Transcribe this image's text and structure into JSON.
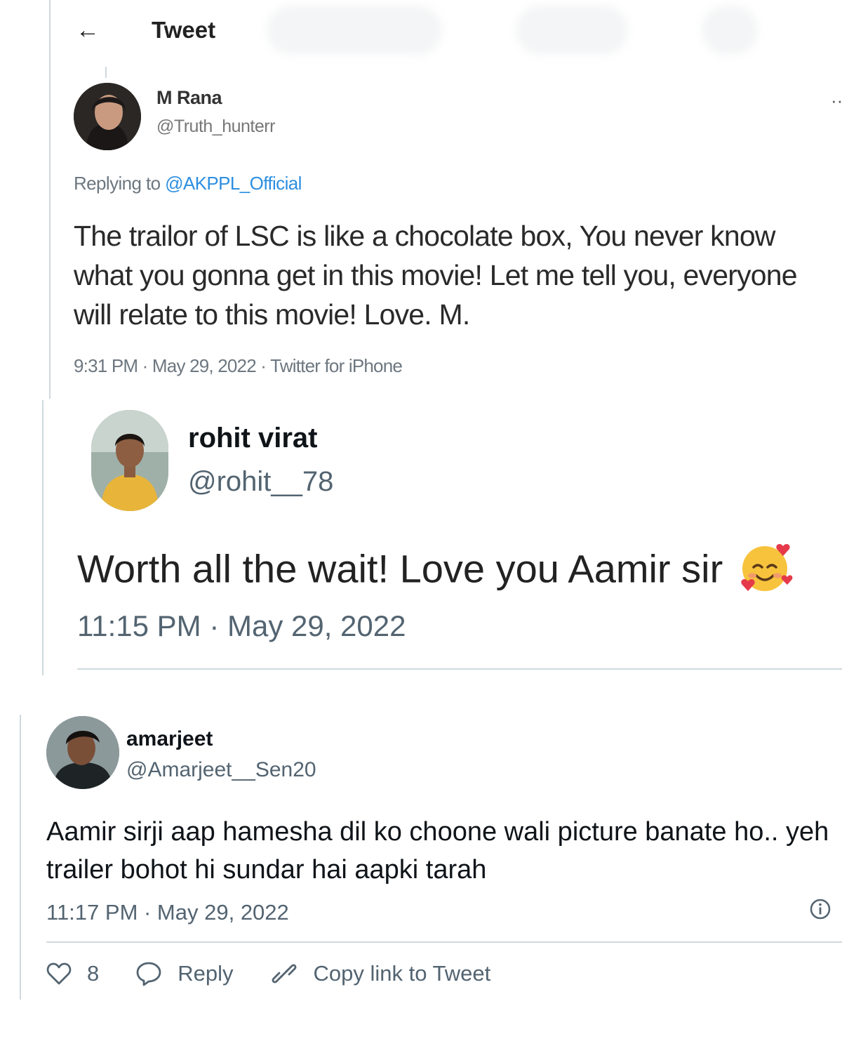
{
  "tweet1": {
    "header_title": "Tweet",
    "name": "M Rana",
    "handle": "@Truth_hunterr",
    "replying_prefix": "Replying to",
    "replying_to": "@AKPPL_Official",
    "text": "The trailor of LSC is like a chocolate box, You never know what you gonna get in this movie! Let me tell you, everyone will relate to this movie! Love. M.",
    "meta": "9:31 PM · May 29, 2022 · Twitter for iPhone"
  },
  "tweet2": {
    "name": "rohit virat",
    "handle": "@rohit__78",
    "text": "Worth all the wait! Love you Aamir sir",
    "emoji": "smiling-face-with-hearts",
    "meta": "11:15 PM · May 29, 2022"
  },
  "tweet3": {
    "name": "amarjeet",
    "handle": "@Amarjeet__Sen20",
    "text": "Aamir sirji aap hamesha dil ko choone wali picture banate ho.. yeh trailer bohot hi sundar hai aapki tarah",
    "meta": "11:17 PM · May 29, 2022",
    "likes": "8",
    "reply_label": "Reply",
    "copy_label": "Copy link to Tweet"
  },
  "icons": {
    "back": "arrow-left-icon",
    "more": "more-dots-icon",
    "info": "info-icon",
    "like": "heart-icon",
    "reply": "speech-bubble-icon",
    "copy": "link-icon"
  },
  "colors": {
    "link": "#2d8fe0",
    "secondary_text": "#536471",
    "divider": "#cfd9de"
  }
}
